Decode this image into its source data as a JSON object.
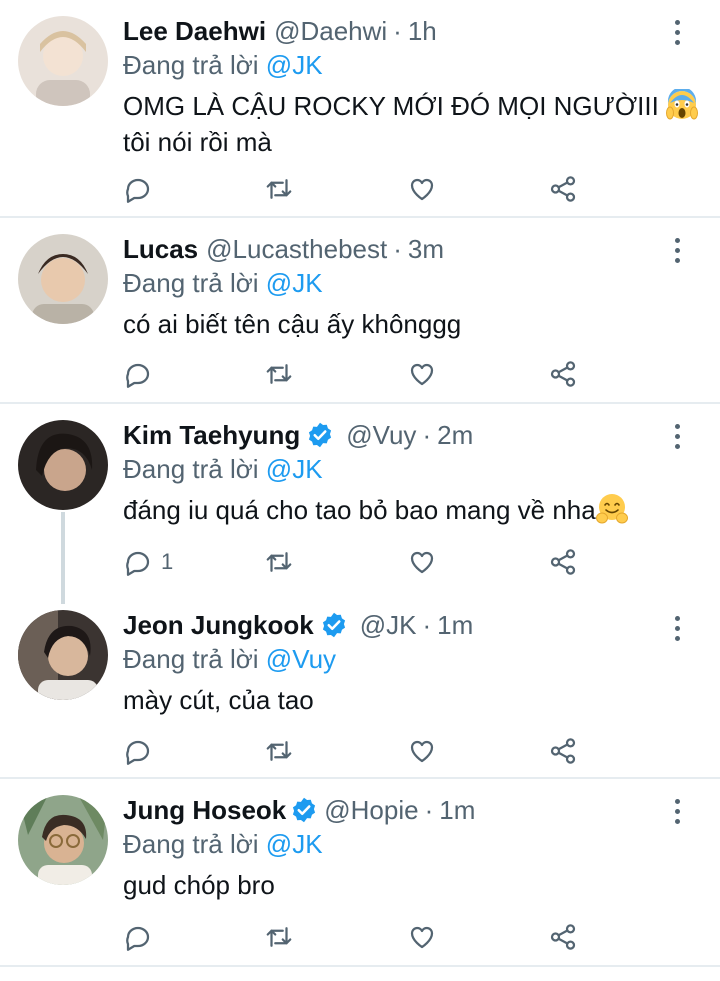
{
  "reply_prefix": "Đang trả lời",
  "tweets": [
    {
      "name": "Lee Daehwi",
      "verified": false,
      "handle": "@Daehwi",
      "dot": "·",
      "time": "1h",
      "reply_to": "@JK",
      "text_line1": "OMG LÀ CẬU ROCKY MỚI ĐÓ MỌI NGƯỜIII",
      "text_line2": "tôi nói rồi mà",
      "emoji": "screaming-face-emoji",
      "reply_count": ""
    },
    {
      "name": "Lucas",
      "verified": false,
      "handle": "@Lucasthebest",
      "dot": "·",
      "time": "3m",
      "reply_to": "@JK",
      "text_line1": "có ai biết tên cậu ấy khônggg",
      "reply_count": ""
    },
    {
      "name": "Kim Taehyung",
      "verified": true,
      "handle": "@Vuy",
      "dot": "·",
      "time": "2m",
      "reply_to": "@JK",
      "text_line1": "đáng iu quá cho tao bỏ bao mang về nha",
      "emoji": "hugging-face-emoji",
      "reply_count": "1"
    },
    {
      "name": "Jeon Jungkook",
      "verified": true,
      "handle": "@JK",
      "dot": "·",
      "time": "1m",
      "reply_to": "@Vuy",
      "text_line1": "mày cút, của tao",
      "reply_count": ""
    },
    {
      "name": "Jung Hoseok",
      "verified": true,
      "handle": "@Hopie",
      "dot": "·",
      "time": "1m",
      "reply_to": "@JK",
      "text_line1": "gud chóp bro",
      "reply_count": ""
    }
  ],
  "colors": {
    "accent": "#1d9bf0",
    "secondary_text": "#536471",
    "divider": "#e6ecf0"
  }
}
